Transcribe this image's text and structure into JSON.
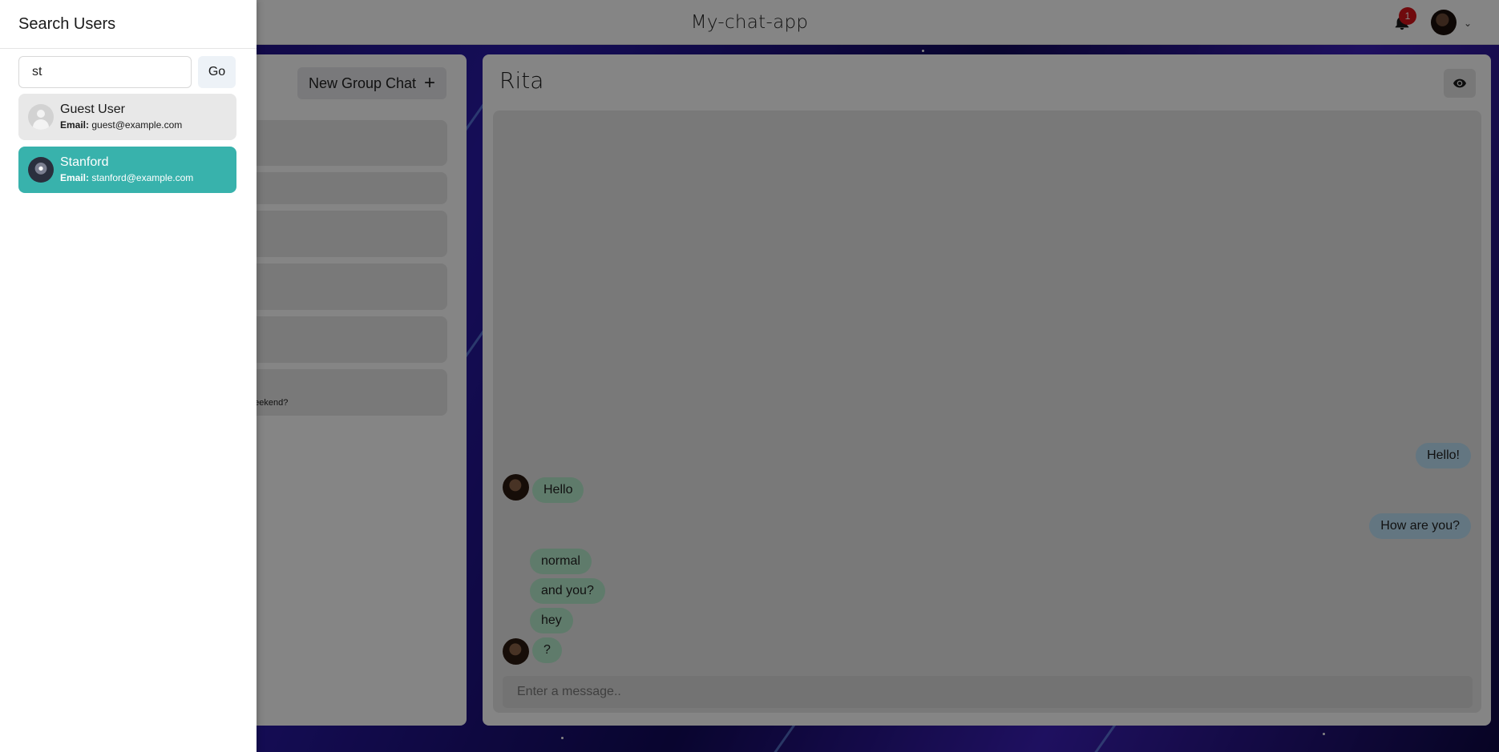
{
  "app": {
    "title": "My-chat-app",
    "notification_count": "1"
  },
  "chat_list": {
    "new_group_label": "New Group Chat",
    "latest_message_preview": "e weekend?"
  },
  "chat": {
    "name": "Rita",
    "messages": [
      {
        "text": "Hello!",
        "from": "me"
      },
      {
        "text": "Hello",
        "from": "other"
      },
      {
        "text": "How are you?",
        "from": "me"
      },
      {
        "text": "normal",
        "from": "other"
      },
      {
        "text": "and you?",
        "from": "other"
      },
      {
        "text": "hey",
        "from": "other"
      },
      {
        "text": "?",
        "from": "other"
      }
    ],
    "input_placeholder": "Enter a message.."
  },
  "search_drawer": {
    "title": "Search Users",
    "query": "st",
    "go_label": "Go",
    "email_label": "Email:",
    "results": [
      {
        "name": "Guest User",
        "email": "guest@example.com"
      },
      {
        "name": "Stanford",
        "email": "stanford@example.com"
      }
    ]
  },
  "colors": {
    "accent": "#38b2ac",
    "badge": "#d7141a",
    "incoming_bubble": "#b7eccd",
    "outgoing_bubble": "#bee3f8"
  },
  "icons": [
    "bell-icon",
    "chevron-down-icon",
    "plus-icon",
    "eye-icon",
    "user-placeholder-icon"
  ]
}
